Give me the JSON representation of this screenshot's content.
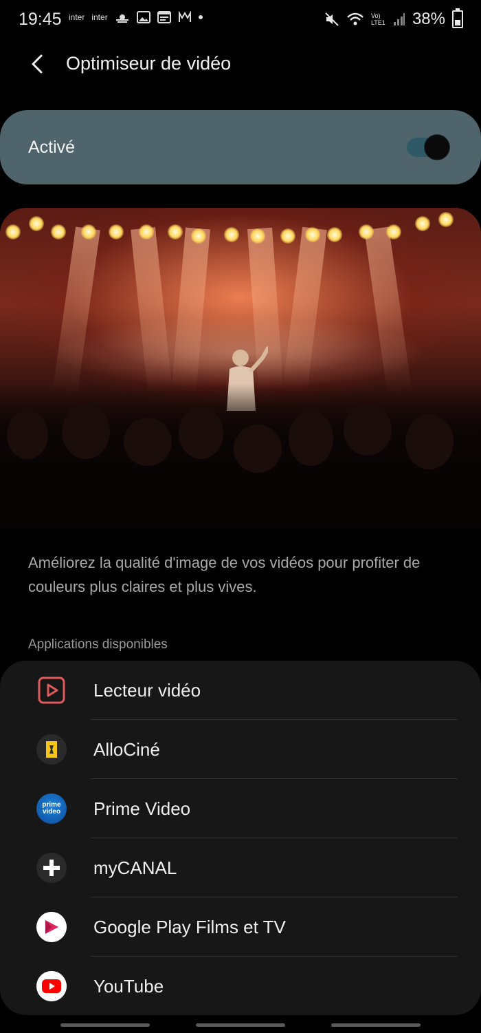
{
  "status_bar": {
    "time": "19:45",
    "carrier_1": "inter",
    "carrier_2": "inter",
    "battery_percent": "38%",
    "network_label": "Vo) LTE1",
    "battery_level": 0.38
  },
  "header": {
    "title": "Optimiseur de vidéo"
  },
  "toggle": {
    "label": "Activé",
    "enabled": true,
    "card_color": "#4f646b"
  },
  "description": "Améliorez la qualité d'image de vos vidéos pour profiter de couleurs plus claires et plus vives.",
  "apps_section": {
    "label": "Applications disponibles",
    "items": [
      {
        "name": "Lecteur vidéo",
        "icon": "play-video-icon"
      },
      {
        "name": "AlloCiné",
        "icon": "allocine-icon"
      },
      {
        "name": "Prime Video",
        "icon": "prime-video-icon"
      },
      {
        "name": "myCANAL",
        "icon": "mycanal-icon"
      },
      {
        "name": "Google Play Films et TV",
        "icon": "google-play-films-icon"
      },
      {
        "name": "YouTube",
        "icon": "youtube-icon"
      }
    ]
  },
  "icons": {
    "prime_text_1": "prime",
    "prime_text_2": "video"
  }
}
